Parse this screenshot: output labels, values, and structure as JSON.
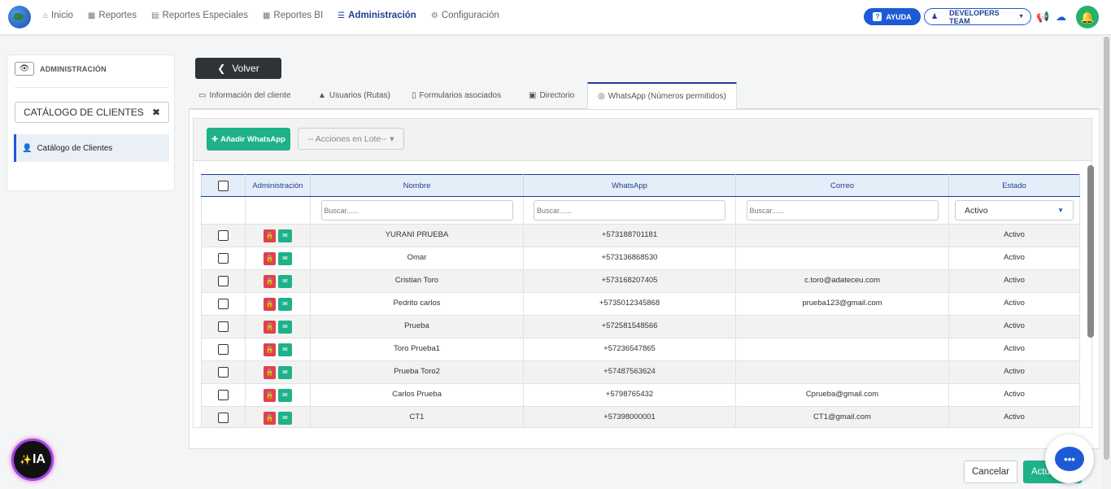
{
  "nav": {
    "items": [
      {
        "icon": "home-icon",
        "glyph": "⌂",
        "label": "Inicio"
      },
      {
        "icon": "grid-icon",
        "glyph": "▦",
        "label": "Reportes"
      },
      {
        "icon": "list-icon",
        "glyph": "▤",
        "label": "Reportes Especiales"
      },
      {
        "icon": "grid-icon",
        "glyph": "▦",
        "label": "Reportes BI"
      },
      {
        "icon": "sliders-icon",
        "glyph": "☰",
        "label": "Administración"
      },
      {
        "icon": "gear-icon",
        "glyph": "⚙",
        "label": "Configuración"
      }
    ],
    "active": "Administración",
    "help_label": "AYUDA",
    "team_label": "DEVELOPERS TEAM"
  },
  "sidebar": {
    "section_label": "ADMINISTRACIÓN",
    "search_value": "CATÁLOGO DE CLIENTES",
    "item_label": "Catálogo de Clientes"
  },
  "main": {
    "back_label": "Volver",
    "tabs": [
      {
        "label": "Información del cliente"
      },
      {
        "label": "Usuarios (Rutas)"
      },
      {
        "label": "Formularios asociados"
      },
      {
        "label": "Directorio"
      },
      {
        "label": "WhatsApp (Números permitidos)"
      }
    ],
    "add_label": "Añadir WhatsApp",
    "batch_label": "-- Acciones en Lote--",
    "columns": [
      "Administración",
      "Nombre",
      "WhatsApp",
      "Correo",
      "Estado"
    ],
    "filter_placeholder": "Buscar......",
    "estado_filter": "Activo",
    "rows": [
      {
        "nombre": "YURANI PRUEBA",
        "whatsapp": "+573188701181",
        "correo": "",
        "estado": "Activo"
      },
      {
        "nombre": "Omar",
        "whatsapp": "+573136868530",
        "correo": "",
        "estado": "Activo"
      },
      {
        "nombre": "Cristian Toro",
        "whatsapp": "+573168207405",
        "correo": "c.toro@adateceu.com",
        "estado": "Activo"
      },
      {
        "nombre": "Pedrito carlos",
        "whatsapp": "+5735012345868",
        "correo": "prueba123@gmail.com",
        "estado": "Activo"
      },
      {
        "nombre": "Prueba",
        "whatsapp": "+572581548566",
        "correo": "",
        "estado": "Activo"
      },
      {
        "nombre": "Toro Prueba1",
        "whatsapp": "+57236547865",
        "correo": "",
        "estado": "Activo"
      },
      {
        "nombre": "Prueba Toro2",
        "whatsapp": "+57487563624",
        "correo": "",
        "estado": "Activo"
      },
      {
        "nombre": "Carlos Prueba",
        "whatsapp": "+5798765432",
        "correo": "Cprueba@gmail.com",
        "estado": "Activo"
      },
      {
        "nombre": "CT1",
        "whatsapp": "+57398000001",
        "correo": "CT1@gmail.com",
        "estado": "Activo"
      }
    ],
    "cancel_label": "Cancelar",
    "update_label": "Actualizar"
  },
  "widgets": {
    "ia_label": "IA"
  },
  "colors": {
    "primary": "#1d5bd6",
    "success": "#1eb18a",
    "danger": "#e0424b",
    "nav_active": "#1f3f8f"
  }
}
